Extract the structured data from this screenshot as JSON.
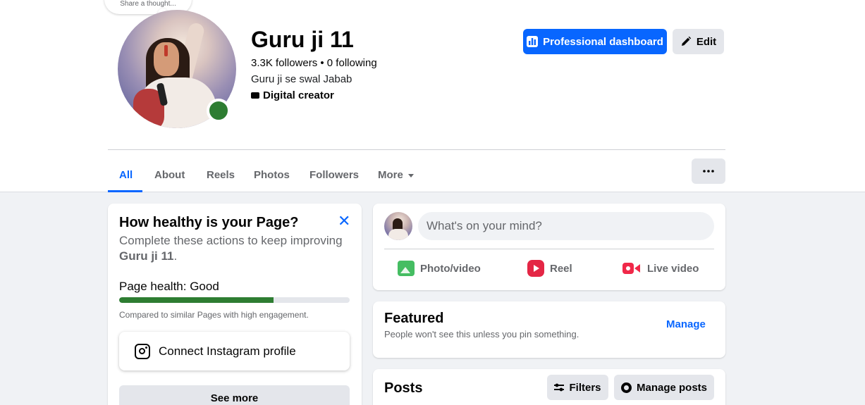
{
  "thought": {
    "text": "Share a thought..."
  },
  "profile": {
    "name": "Guru ji 11",
    "stats": "3.3K followers • 0 following",
    "bio": "Guru ji se swal Jabab",
    "category": "Digital creator"
  },
  "actions": {
    "professional_dashboard": "Professional dashboard",
    "edit": "Edit"
  },
  "tabs": [
    {
      "label": "All",
      "active": true
    },
    {
      "label": "About"
    },
    {
      "label": "Reels"
    },
    {
      "label": "Photos"
    },
    {
      "label": "Followers"
    },
    {
      "label": "More"
    }
  ],
  "health": {
    "title": "How healthy is your Page?",
    "desc_prefix": "Complete these actions to keep improving",
    "desc_name": "Guru ji 11",
    "health_label": "Page health: Good",
    "progress": 0.67,
    "progress_color": "#2e7d32",
    "note": "Compared to similar Pages with high engagement.",
    "instagram": "Connect Instagram profile",
    "see_more": "See more"
  },
  "composer": {
    "placeholder": "What's on your mind?",
    "photo": "Photo/video",
    "reel": "Reel",
    "live": "Live video"
  },
  "featured": {
    "title": "Featured",
    "subtitle": "People won't see this unless you pin something.",
    "manage": "Manage"
  },
  "posts": {
    "title": "Posts",
    "filters": "Filters",
    "manage": "Manage posts"
  },
  "colors": {
    "accent": "#0866ff",
    "online": "#2e7d32"
  }
}
